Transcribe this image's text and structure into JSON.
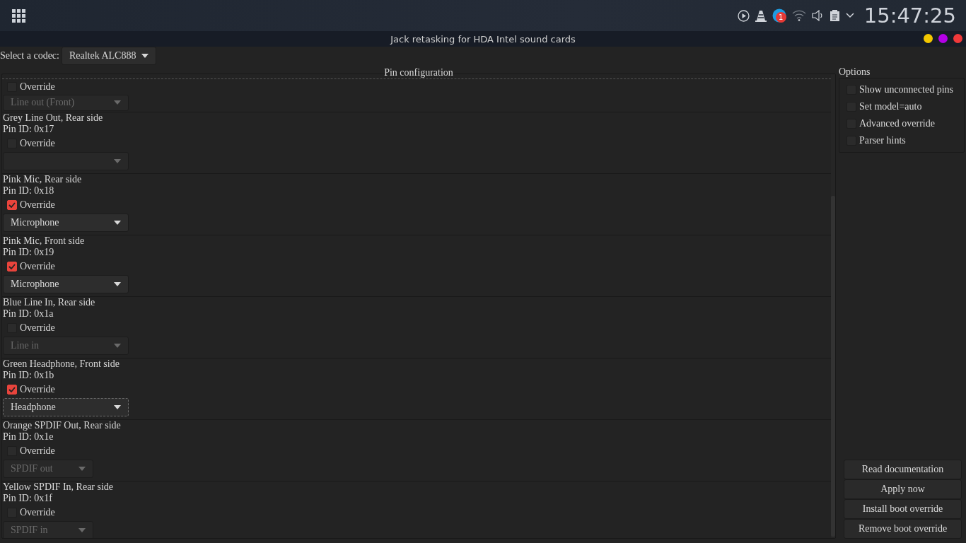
{
  "top_panel": {
    "clock": "15:47:25",
    "notification_count": "1"
  },
  "window": {
    "title": "Jack retasking for HDA Intel sound cards"
  },
  "codec": {
    "label": "Select a codec:",
    "value": "Realtek ALC888"
  },
  "pin_configuration": {
    "title": "Pin configuration",
    "pins": [
      {
        "override_label": "Override",
        "override": false,
        "value": "Line out (Front)",
        "kind": "analog",
        "focused": false
      },
      {
        "title": "Grey Line Out, Rear side",
        "pin_id": "Pin ID: 0x17",
        "override_label": "Override",
        "override": false,
        "kind": "analog",
        "focused": false
      },
      {
        "title": "Pink Mic, Rear side",
        "pin_id": "Pin ID: 0x18",
        "override_label": "Override",
        "override": true,
        "value": "Microphone",
        "kind": "analog",
        "focused": false
      },
      {
        "title": "Pink Mic, Front side",
        "pin_id": "Pin ID: 0x19",
        "override_label": "Override",
        "override": true,
        "value": "Microphone",
        "kind": "analog",
        "focused": false
      },
      {
        "title": "Blue Line In, Rear side",
        "pin_id": "Pin ID: 0x1a",
        "override_label": "Override",
        "override": false,
        "value": "Line in",
        "kind": "analog",
        "focused": false
      },
      {
        "title": "Green Headphone, Front side",
        "pin_id": "Pin ID: 0x1b",
        "override_label": "Override",
        "override": true,
        "value": "Headphone",
        "kind": "analog",
        "focused": true
      },
      {
        "title": "Orange SPDIF Out, Rear side",
        "pin_id": "Pin ID: 0x1e",
        "override_label": "Override",
        "override": false,
        "value": "SPDIF out",
        "kind": "digital",
        "focused": false
      },
      {
        "title": "Yellow SPDIF In, Rear side",
        "pin_id": "Pin ID: 0x1f",
        "override_label": "Override",
        "override": false,
        "value": "SPDIF in",
        "kind": "digital",
        "focused": false
      }
    ]
  },
  "options": {
    "title": "Options",
    "items": [
      {
        "label": "Show unconnected pins",
        "checked": false
      },
      {
        "label": "Set model=auto",
        "checked": false
      },
      {
        "label": "Advanced override",
        "checked": false
      },
      {
        "label": "Parser hints",
        "checked": false
      }
    ]
  },
  "buttons": [
    "Read documentation",
    "Apply now",
    "Install boot override",
    "Remove boot override"
  ]
}
